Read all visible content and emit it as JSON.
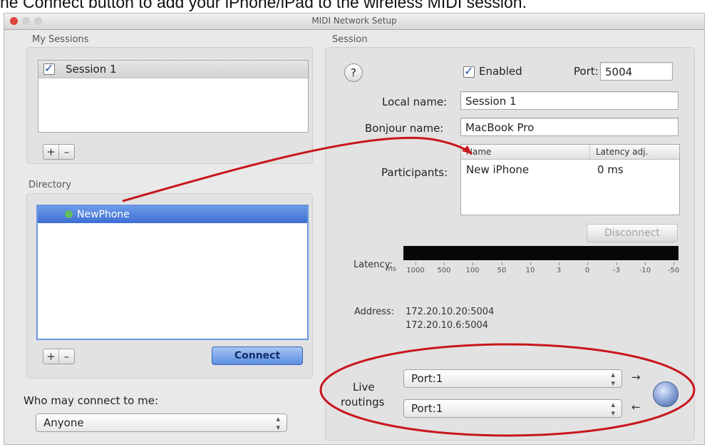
{
  "caption": "he Connect button to add your iPhone/iPad to the wireless MIDI session.",
  "window": {
    "title": "MIDI Network Setup"
  },
  "my_sessions": {
    "label": "My Sessions",
    "items": [
      {
        "label": "Session 1",
        "checked": true
      }
    ],
    "add": "+",
    "remove": "–"
  },
  "directory": {
    "label": "Directory",
    "items": [
      {
        "label": "NewPhone",
        "selected": true
      }
    ],
    "add": "+",
    "remove": "–",
    "connect_label": "Connect"
  },
  "who_connect": {
    "label": "Who may connect to me:",
    "value": "Anyone"
  },
  "session": {
    "label": "Session",
    "help": "?",
    "enabled_label": "Enabled",
    "enabled": true,
    "port_label": "Port:",
    "port_value": "5004",
    "local_name_label": "Local name:",
    "local_name_value": "Session 1",
    "bonjour_label": "Bonjour name:",
    "bonjour_value": "MacBook Pro",
    "participants_label": "Participants:",
    "participants_columns": [
      "Name",
      "Latency adj."
    ],
    "participants": [
      {
        "name": "New iPhone",
        "latency": "0 ms"
      }
    ],
    "disconnect_label": "Disconnect",
    "latency_label": "Latency:",
    "latency_scale_unit": "ms",
    "latency_scale": [
      "1000",
      "500",
      "100",
      "50",
      "10",
      "3",
      "0",
      "-3",
      "-10",
      "-50"
    ],
    "address_label": "Address:",
    "addresses": [
      "172.20.10.20:5004",
      "172.20.10.6:5004"
    ],
    "live_routings_label": [
      "Live",
      "routings"
    ],
    "routing_in": "Port:1",
    "routing_out": "Port:1",
    "route_in_arrow": "→",
    "route_out_arrow": "←"
  },
  "colors": {
    "accent_blue": "#3d6ed3",
    "annotation_red": "#c8161d",
    "window_bg": "#e9e9e9"
  }
}
